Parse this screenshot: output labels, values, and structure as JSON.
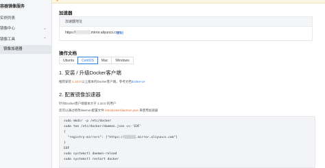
{
  "sidebar": {
    "title": "容器镜像服务",
    "items": [
      {
        "label": "实例列表",
        "chevron": ""
      },
      {
        "label": "镜像中心",
        "chevron": "⌄"
      },
      {
        "label": "镜像工具",
        "chevron": "⌃"
      },
      {
        "label": "镜像加速器",
        "chevron": ""
      }
    ]
  },
  "accelerator": {
    "section_title": "加速器",
    "box_header": "加速器地址",
    "url": "https://░░░░░░.mirror.aliyuncs.com",
    "copy_label": "复制"
  },
  "docs": {
    "section_title": "操作文档",
    "tabs": [
      "Ubuntu",
      "CentOS",
      "Mac",
      "Windows"
    ],
    "active_tab": "CentOS",
    "step1_title": "1. 安装 / 升级Docker客户端",
    "step1_text_prefix": "推荐安装 ",
    "step1_text_version": "1.10.0",
    "step1_text_middle": " 以上版本的Docker客户端，参考文档",
    "step1_link": "docker-ce",
    "step2_title": "2. 配置镜像加速器",
    "step2_text1": "针对Docker客户端版本大于 1.10.0 的用户",
    "step2_text2_prefix": "您可以通过修改daemon配置文件 ",
    "step2_text2_path": "/etc/docker/daemon.json",
    "step2_text2_suffix": " 来使用加速器",
    "code_lines": [
      "sudo mkdir -p /etc/docker",
      "sudo tee /etc/docker/daemon.json <<-'EOF'",
      "{",
      "  \"registry-mirrors\": [\"https://░░░░░░.mirror.aliyuncs.com\"]",
      "}",
      "EOF",
      "sudo systemctl daemon-reload",
      "sudo systemctl restart docker"
    ]
  },
  "colors": {
    "accent": "#2a7be4",
    "warning": "#e8a33b",
    "sidebar_bg": "#f5f6f8"
  }
}
